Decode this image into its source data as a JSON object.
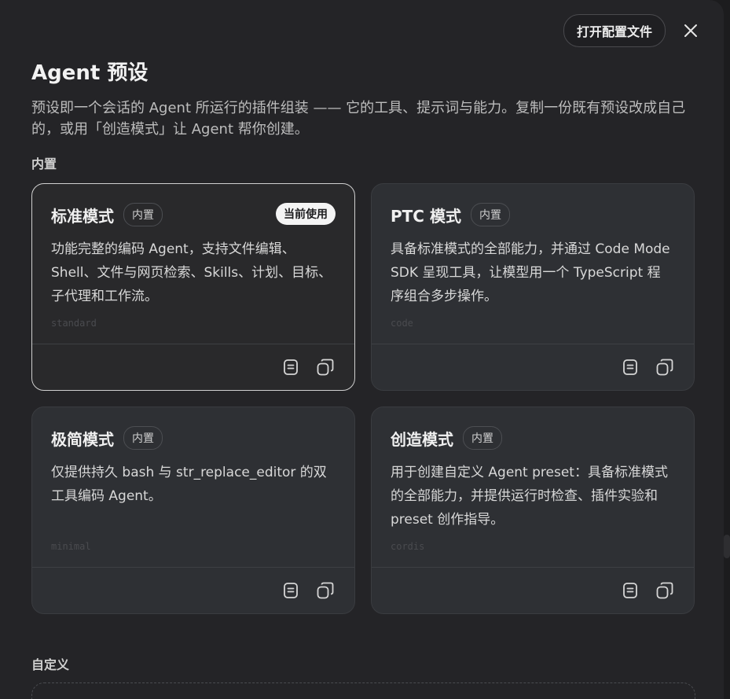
{
  "header": {
    "open_config_label": "打开配置文件",
    "title": "Agent 预设",
    "description": "预设即一个会话的 Agent 所运行的插件组装 —— 它的工具、提示词与能力。复制一份既有预设改成自己的，或用「创造模式」让 Agent 帮你创建。"
  },
  "sections": {
    "builtin_label": "内置",
    "custom_label": "自定义"
  },
  "cards": [
    {
      "title": "标准模式",
      "badge": "内置",
      "current": "当前使用",
      "desc": "功能完整的编码 Agent，支持文件编辑、Shell、文件与网页检索、Skills、计划、目标、子代理和工作流。",
      "id": "standard"
    },
    {
      "title": "PTC 模式",
      "badge": "内置",
      "desc": "具备标准模式的全部能力，并通过 Code Mode SDK 呈现工具，让模型用一个 TypeScript 程序组合多步操作。",
      "id": "code"
    },
    {
      "title": "极简模式",
      "badge": "内置",
      "desc": "仅提供持久 bash 与 str_replace_editor 的双工具编码 Agent。",
      "id": "minimal"
    },
    {
      "title": "创造模式",
      "badge": "内置",
      "desc": "用于创建自定义 Agent preset：具备标准模式的全部能力，并提供运行时检查、插件实验和 preset 创作指导。",
      "id": "cordis"
    }
  ],
  "icons": {
    "close": "close-icon",
    "view": "document-icon",
    "copy": "copy-icon"
  }
}
